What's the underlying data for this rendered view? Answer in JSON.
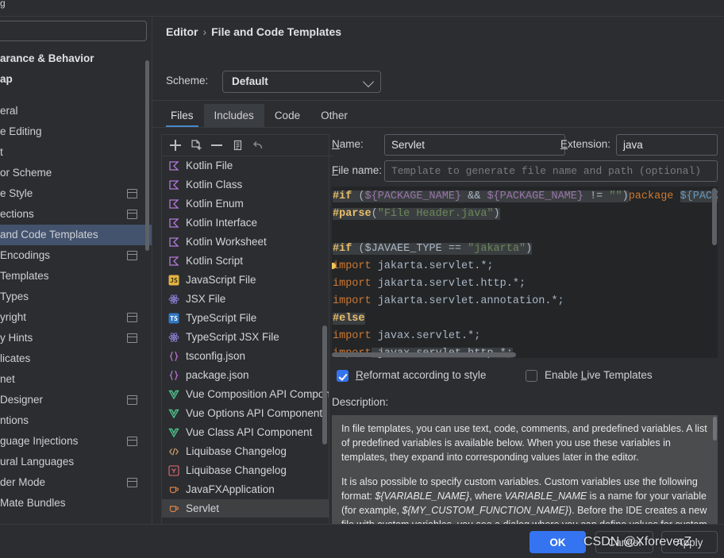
{
  "window": {
    "title_fragment": "g",
    "nav_back_icon": "arrow-left-icon",
    "nav_forward_icon": "arrow-right-icon"
  },
  "sidebar": {
    "search": {
      "value": "",
      "placeholder": ""
    },
    "items": [
      {
        "label": "arance & Behavior",
        "bold": true,
        "selected": false,
        "copy": false
      },
      {
        "label": "ap",
        "bold": true,
        "selected": false,
        "copy": false
      },
      {
        "label": "",
        "bold": false,
        "selected": false,
        "copy": false,
        "spacer": true
      },
      {
        "label": "eral",
        "bold": false,
        "selected": false,
        "copy": false
      },
      {
        "label": "e Editing",
        "bold": false,
        "selected": false,
        "copy": false
      },
      {
        "label": "t",
        "bold": false,
        "selected": false,
        "copy": false
      },
      {
        "label": "or Scheme",
        "bold": false,
        "selected": false,
        "copy": false
      },
      {
        "label": "e Style",
        "bold": false,
        "selected": false,
        "copy": true
      },
      {
        "label": "ections",
        "bold": false,
        "selected": false,
        "copy": true
      },
      {
        "label": "and Code Templates",
        "bold": false,
        "selected": true,
        "copy": false
      },
      {
        "label": "Encodings",
        "bold": false,
        "selected": false,
        "copy": true
      },
      {
        "label": "Templates",
        "bold": false,
        "selected": false,
        "copy": false
      },
      {
        "label": "Types",
        "bold": false,
        "selected": false,
        "copy": false
      },
      {
        "label": "yright",
        "bold": false,
        "selected": false,
        "copy": true
      },
      {
        "label": "y Hints",
        "bold": false,
        "selected": false,
        "copy": true
      },
      {
        "label": "licates",
        "bold": false,
        "selected": false,
        "copy": false
      },
      {
        "label": "net",
        "bold": false,
        "selected": false,
        "copy": false
      },
      {
        "label": " Designer",
        "bold": false,
        "selected": false,
        "copy": true
      },
      {
        "label": "ntions",
        "bold": false,
        "selected": false,
        "copy": false
      },
      {
        "label": "guage Injections",
        "bold": false,
        "selected": false,
        "copy": true
      },
      {
        "label": "ural Languages",
        "bold": false,
        "selected": false,
        "copy": false
      },
      {
        "label": "der Mode",
        "bold": false,
        "selected": false,
        "copy": true
      },
      {
        "label": "Mate Bundles",
        "bold": false,
        "selected": false,
        "copy": false
      }
    ]
  },
  "header": {
    "breadcrumb_parent": "Editor",
    "breadcrumb_separator": "›",
    "breadcrumb_current": "File and Code Templates",
    "scheme_label": "Scheme:",
    "scheme_value": "Default"
  },
  "tabs": [
    {
      "label": "Files",
      "state": "active"
    },
    {
      "label": "Includes",
      "state": "hover"
    },
    {
      "label": "Code",
      "state": "normal"
    },
    {
      "label": "Other",
      "state": "normal"
    }
  ],
  "list_toolbar": [
    {
      "name": "add-template-button",
      "icon": "plus-icon"
    },
    {
      "name": "add-child-template-button",
      "icon": "file-add-icon"
    },
    {
      "name": "remove-template-button",
      "icon": "minus-icon"
    },
    {
      "name": "copy-template-button",
      "icon": "copy-icon"
    },
    {
      "name": "reset-template-button",
      "icon": "undo-icon"
    }
  ],
  "template_list": [
    {
      "label": "Kotlin File",
      "icon": "kotlin-icon",
      "selected": false
    },
    {
      "label": "Kotlin Class",
      "icon": "kotlin-icon",
      "selected": false
    },
    {
      "label": "Kotlin Enum",
      "icon": "kotlin-icon",
      "selected": false
    },
    {
      "label": "Kotlin Interface",
      "icon": "kotlin-icon",
      "selected": false
    },
    {
      "label": "Kotlin Worksheet",
      "icon": "kotlin-icon",
      "selected": false
    },
    {
      "label": "Kotlin Script",
      "icon": "kotlin-icon",
      "selected": false
    },
    {
      "label": "JavaScript File",
      "icon": "javascript-icon",
      "selected": false
    },
    {
      "label": "JSX File",
      "icon": "react-icon",
      "selected": false
    },
    {
      "label": "TypeScript File",
      "icon": "typescript-icon",
      "selected": false
    },
    {
      "label": "TypeScript JSX File",
      "icon": "react-icon",
      "selected": false
    },
    {
      "label": "tsconfig.json",
      "icon": "json-icon",
      "selected": false
    },
    {
      "label": "package.json",
      "icon": "json-icon",
      "selected": false
    },
    {
      "label": "Vue Composition API Component",
      "icon": "vue-icon",
      "selected": false
    },
    {
      "label": "Vue Options API Component",
      "icon": "vue-icon",
      "selected": false
    },
    {
      "label": "Vue Class API Component",
      "icon": "vue-icon",
      "selected": false
    },
    {
      "label": "Liquibase Changelog",
      "icon": "xml-icon",
      "selected": false
    },
    {
      "label": "Liquibase Changelog",
      "icon": "yaml-icon",
      "selected": false
    },
    {
      "label": "JavaFXApplication",
      "icon": "java-icon",
      "selected": false
    },
    {
      "label": "Servlet",
      "icon": "java-icon",
      "selected": true
    }
  ],
  "fields": {
    "name_label": "Name:",
    "name_value": "Servlet",
    "extension_label": "Extension:",
    "extension_value": "java",
    "filename_label": "File name:",
    "filename_value": "",
    "filename_placeholder": "Template to generate file name and path (optional)"
  },
  "editor": {
    "lines": [
      [
        {
          "t": "#if",
          "c": "dir",
          "hl": true
        },
        {
          "t": " (",
          "c": "plain",
          "hl": true
        },
        {
          "t": "${PACKAGE_NAME}",
          "c": "var",
          "hl": true
        },
        {
          "t": " && ",
          "c": "plain",
          "hl": true
        },
        {
          "t": "${PACKAGE_NAME}",
          "c": "var",
          "hl": true
        },
        {
          "t": " != ",
          "c": "plain",
          "hl": true
        },
        {
          "t": "\"\"",
          "c": "str",
          "hl": true
        },
        {
          "t": ")",
          "c": "plain",
          "hl": true
        },
        {
          "t": "package ",
          "c": "txt",
          "hl": false
        },
        {
          "t": "${PACKAG",
          "c": "var2",
          "hl": true
        }
      ],
      [
        {
          "t": "#parse",
          "c": "dir",
          "hl": true
        },
        {
          "t": "(",
          "c": "plain",
          "hl": true
        },
        {
          "t": "\"File Header.java\"",
          "c": "str",
          "hl": true
        },
        {
          "t": ")",
          "c": "plain",
          "hl": true
        }
      ],
      [],
      [
        {
          "t": "#if",
          "c": "dir",
          "hl": true
        },
        {
          "t": " ($JAVAEE_TYPE == ",
          "c": "plain",
          "hl": true
        },
        {
          "t": "\"jakarta\"",
          "c": "str",
          "hl": true
        },
        {
          "t": ")",
          "c": "plain",
          "hl": true
        }
      ],
      [
        {
          "t": "import",
          "c": "txt",
          "hl": false
        },
        {
          "t": " jakarta.servlet.*;",
          "c": "plain",
          "hl": false
        }
      ],
      [
        {
          "t": "import",
          "c": "txt",
          "hl": false
        },
        {
          "t": " jakarta.servlet.http.*;",
          "c": "plain",
          "hl": false
        }
      ],
      [
        {
          "t": "import",
          "c": "txt",
          "hl": false
        },
        {
          "t": " jakarta.servlet.annotation.*;",
          "c": "plain",
          "hl": false
        }
      ],
      [
        {
          "t": "#else",
          "c": "dir",
          "hl": true
        }
      ],
      [
        {
          "t": "import",
          "c": "txt",
          "hl": false
        },
        {
          "t": " javax.servlet.*;",
          "c": "plain",
          "hl": false
        }
      ],
      [
        {
          "t": "import",
          "c": "txt",
          "hl": false
        },
        {
          "t": " javax.servlet.http.*;",
          "c": "plain",
          "hl": true
        }
      ]
    ]
  },
  "options": {
    "reformat_label": "Reformat according to style",
    "reformat_mnemonic": "R",
    "reformat_checked": true,
    "live_templates_label": "Enable Live Templates",
    "live_templates_mnemonic": "L",
    "live_templates_checked": false
  },
  "description": {
    "label": "Description:",
    "paragraph1": "In file templates, you can use text, code, comments, and predefined variables. A list of predefined variables is available below. When you use these variables in templates, they expand into corresponding values later in the editor.",
    "paragraph2_a": "It is also possible to specify custom variables. Custom variables use the following format: ",
    "paragraph2_var1": "${VARIABLE_NAME}",
    "paragraph2_b": ", where ",
    "paragraph2_var2": "VARIABLE_NAME",
    "paragraph2_c": " is a name for your variable (for example, ",
    "paragraph2_var3": "${MY_CUSTOM_FUNCTION_NAME}",
    "paragraph2_d": "). Before the IDE creates a new file with custom variables, you see a dialog where you can define values for custom variables in the template."
  },
  "buttons": {
    "ok": "OK",
    "cancel": "Cancel",
    "apply": "Apply"
  },
  "watermark": "CSDN @XforeverZ",
  "colors": {
    "accent": "#3574f0",
    "selection": "#43536d",
    "panel_bg": "#2b2d30",
    "editor_bg": "#232527",
    "description_bg": "#4a4c4e"
  }
}
